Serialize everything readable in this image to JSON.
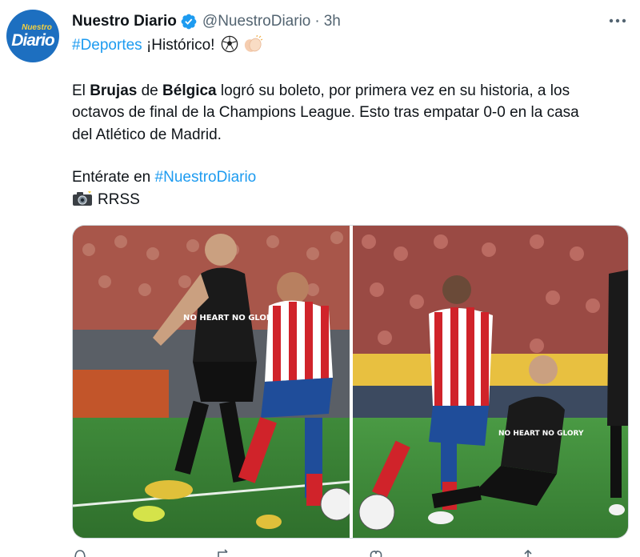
{
  "tweet": {
    "avatar_small": "Nuestro",
    "avatar_big": "Diario",
    "display_name": "Nuestro Diario",
    "handle": "@NuestroDiario",
    "separator": "·",
    "time": "3h",
    "hashtag_deportes": "#Deportes",
    "intro": " ¡Histórico! ",
    "line1": {
      "t1": "El ",
      "b1": "Brujas",
      "t2": " de ",
      "b2": "Bélgica",
      "t3": " logró su boleto, por primera vez en su historia, a los"
    },
    "line2": "octavos de final de la Champions League. Esto tras empatar 0-0 en la casa",
    "line3": "del Atlético de Madrid.",
    "entérate": "Entérate en ",
    "hashtag_nd": "#NuestroDiario",
    "credit": "RRSS",
    "photo1_text": "NO HEART NO GLORY",
    "photo2_text": "NO HEART NO GLORY"
  },
  "colors": {
    "link": "#1d9bf0",
    "text": "#0f1419",
    "secondary": "#536471",
    "verified": "#1d9bf0"
  },
  "icons": [
    "verified-badge-icon",
    "more-options-icon",
    "soccer-ball-emoji",
    "clapping-hands-emoji",
    "camera-flash-emoji",
    "reply-icon",
    "retweet-icon",
    "like-icon",
    "share-icon"
  ]
}
